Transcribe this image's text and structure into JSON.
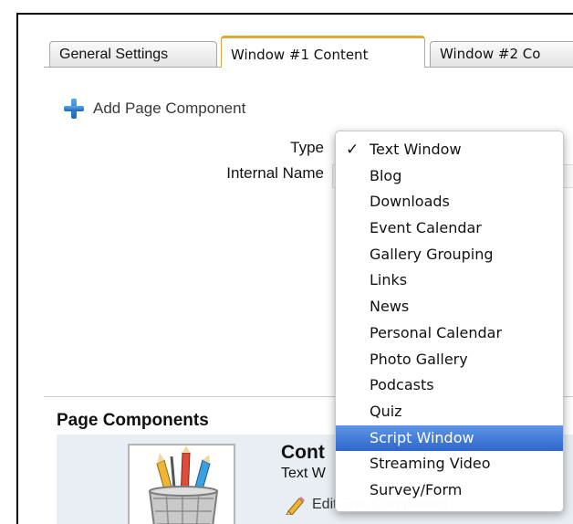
{
  "tabs": [
    {
      "label": "General Settings",
      "active": false
    },
    {
      "label": "Window #1 Content",
      "active": true
    },
    {
      "label": "Window #2 Co",
      "active": false
    }
  ],
  "add_component": {
    "label": "Add Page Component",
    "icon": "plus-icon"
  },
  "form": {
    "type_label": "Type",
    "internal_name_label": "Internal Name"
  },
  "type_menu": {
    "selected": "Text Window",
    "highlighted": "Script Window",
    "check_glyph": "✓",
    "items": [
      "Text Window",
      "Blog",
      "Downloads",
      "Event Calendar",
      "Gallery Grouping",
      "Links",
      "News",
      "Personal Calendar",
      "Photo Gallery",
      "Podcasts",
      "Quiz",
      "Script Window",
      "Streaming Video",
      "Survey/Form"
    ]
  },
  "page_components": {
    "title": "Page Components",
    "component_title": "Cont",
    "component_type": "Text W",
    "edit_label": "Edit This Component"
  },
  "colors": {
    "active_tab_border": "#e2a73a",
    "menu_highlight": "#3875d7",
    "component_row_bg": "#e9eef4",
    "plus_icon": "#2a78c9"
  }
}
